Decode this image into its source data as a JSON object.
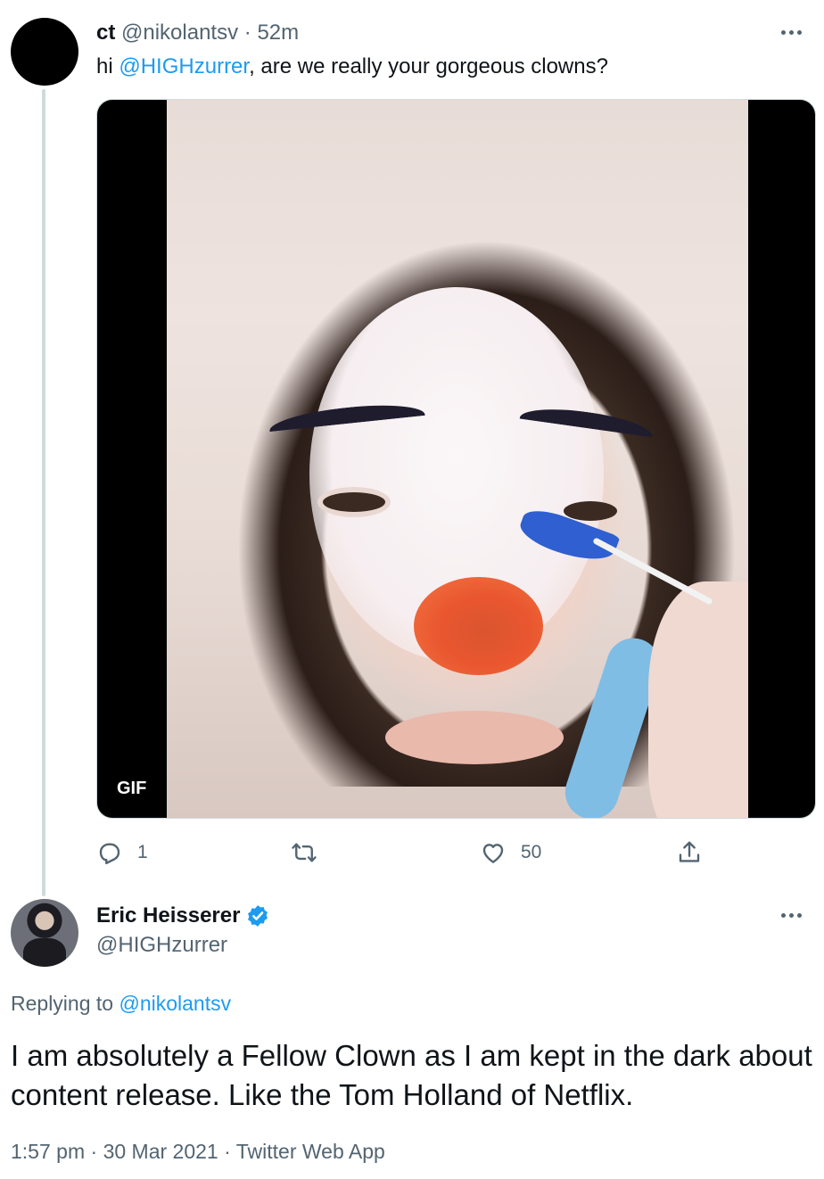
{
  "tweet1": {
    "name": "ct",
    "handle": "@nikolantsv",
    "separator": "·",
    "time": "52m",
    "text_prefix": "hi ",
    "mention": "@HIGHzurrer",
    "text_suffix": ", are we really your gorgeous clowns?",
    "media_badge": "GIF",
    "actions": {
      "reply_count": "1",
      "retweet_count": "",
      "like_count": "50"
    }
  },
  "reply": {
    "name": "Eric Heisserer",
    "handle": "@HIGHzurrer",
    "replying_prefix": "Replying to ",
    "replying_handle": "@nikolantsv",
    "text": "I am absolutely a Fellow Clown as I am kept in the dark about content release. Like the Tom Holland of Netflix.",
    "time": "1:57 pm",
    "sep1": "·",
    "date": "30 Mar 2021",
    "sep2": "·",
    "source": "Twitter Web App"
  },
  "colors": {
    "link": "#1d9bf0",
    "secondary_text": "#536471",
    "primary_text": "#0f1419",
    "thread_line": "#cfd9de"
  },
  "icons": [
    "more-icon",
    "reply-icon",
    "retweet-icon",
    "like-icon",
    "share-icon",
    "verified-badge-icon"
  ]
}
